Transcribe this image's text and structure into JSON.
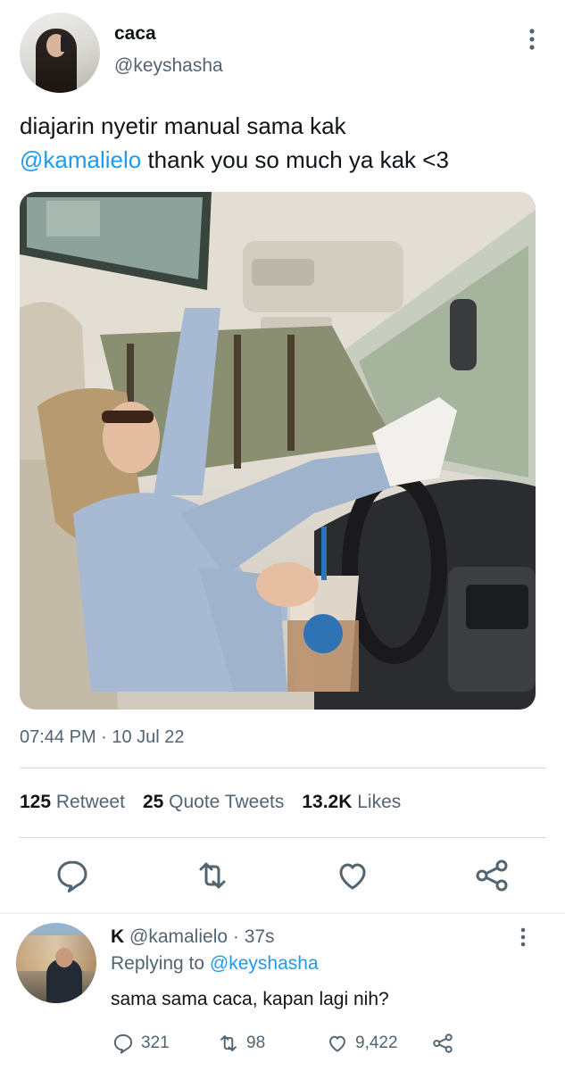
{
  "tweet": {
    "display_name": "caca",
    "handle": "@keyshasha",
    "text_line1": "diajarin nyetir manual sama kak",
    "mention": "@kamalielo",
    "text_line2_rest": " thank you so much ya kak <3",
    "timestamp": "07:44 PM · 10 Jul 22"
  },
  "stats": {
    "retweets_count": "125",
    "retweets_label": "Retweet",
    "quotes_count": "25",
    "quotes_label": "Quote Tweets",
    "likes_count": "13.2K",
    "likes_label": "Likes"
  },
  "actions": [
    "reply-icon",
    "retweet-icon",
    "like-icon",
    "share-icon"
  ],
  "reply": {
    "display_name": "K",
    "handle_time": "@kamalielo · 37s",
    "replying_prefix": "Replying to ",
    "replying_handle": "@keyshasha",
    "text": "sama sama caca, kapan lagi nih?",
    "reply_count": "321",
    "retweet_count": "98",
    "like_count": "9,422"
  },
  "colors": {
    "accent": "#1d9bf0",
    "text": "#0f1419",
    "secondary": "#536471",
    "divider": "#cfd9de"
  }
}
